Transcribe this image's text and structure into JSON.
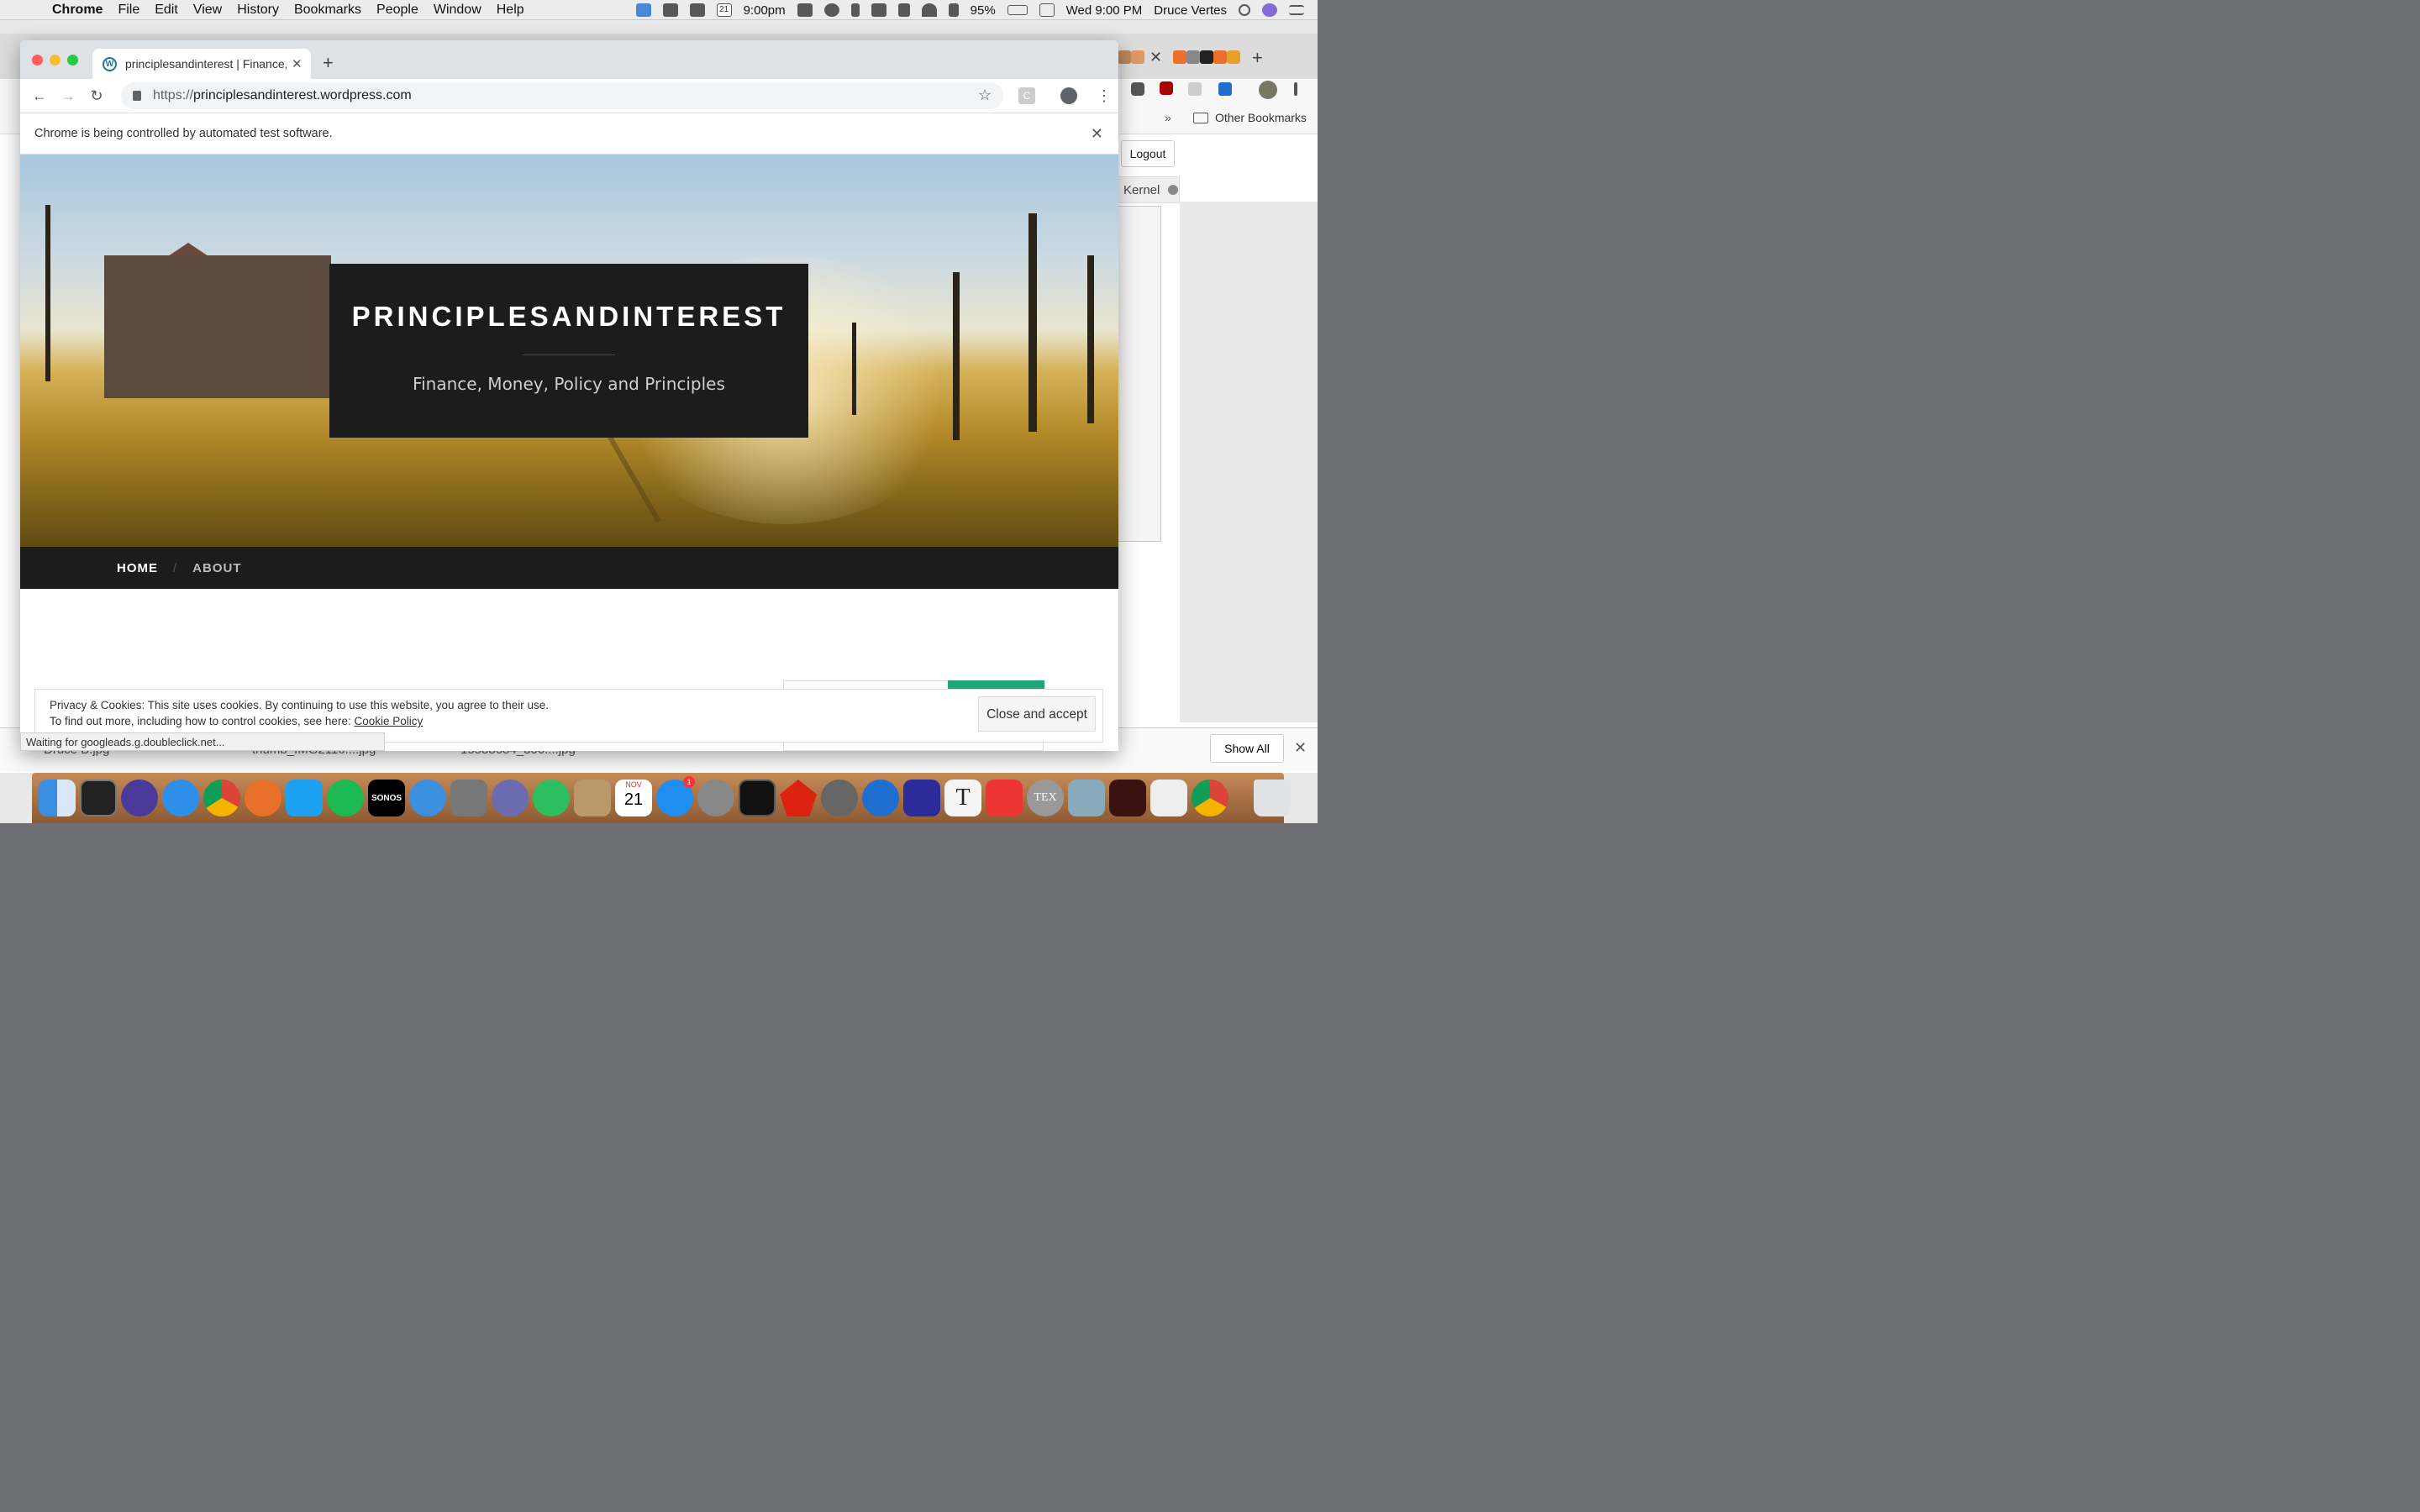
{
  "menubar": {
    "app_name": "Chrome",
    "items": [
      "File",
      "Edit",
      "View",
      "History",
      "Bookmarks",
      "People",
      "Window",
      "Help"
    ],
    "clock_short": "9:00pm",
    "battery": "95%",
    "datetime": "Wed 9:00 PM",
    "user": "Druce Vertes",
    "calendar_day": "21"
  },
  "browser": {
    "tab_title": "principlesandinterest | Finance, Money, Policy and Principles",
    "url_scheme": "https://",
    "url_host": "principlesandinterest.wordpress.com",
    "infobar_text": "Chrome is being controlled by automated test software.",
    "ext_c_label": "C",
    "status_text": "Waiting for googleads.g.doubleclick.net..."
  },
  "site": {
    "title": "PRINCIPLESANDINTEREST",
    "tagline": "Finance, Money, Policy and Principles",
    "nav": {
      "home": "HOME",
      "about": "ABOUT"
    }
  },
  "cookie_banner": {
    "line1": "Privacy & Cookies: This site uses cookies. By continuing to use this website, you agree to their use.",
    "line2_prefix": "To find out more, including how to control cookies, see here:",
    "link": "Cookie Policy",
    "button": "Close and accept"
  },
  "background_window": {
    "other_bookmarks": "Other Bookmarks",
    "logout": "Logout",
    "kernel": "Kernel",
    "show_all": "Show All",
    "downloads": [
      "Druce B.jpg",
      "thumb_IMG2116....jpg",
      "15588684_806....jpg"
    ]
  },
  "dock": {
    "sonos_label": "SONOS",
    "calendar_month": "NOV",
    "calendar_day": "21",
    "appstore_badge": "1",
    "textedit_label": "T",
    "tex_label": "TEX"
  },
  "colors": {
    "hero_panel": "#1c1c1c",
    "accent_green": "#1ea57a",
    "wordpress_blue": "#21759b"
  }
}
